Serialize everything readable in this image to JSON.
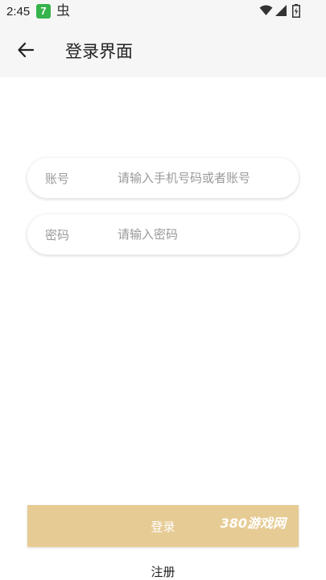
{
  "status_bar": {
    "time": "2:45",
    "app_badge": "7",
    "icons": [
      "bug-icon",
      "wifi-icon",
      "signal-icon",
      "battery-icon"
    ]
  },
  "header": {
    "title": "登录界面",
    "back_icon": "arrow-left-icon"
  },
  "form": {
    "account": {
      "label": "账号",
      "placeholder": "请输入手机号码或者账号",
      "value": ""
    },
    "password": {
      "label": "密码",
      "placeholder": "请输入密码",
      "value": ""
    }
  },
  "actions": {
    "login_label": "登录",
    "watermark": "380游戏网",
    "register_label": "注册"
  },
  "colors": {
    "accent": "#e6cb94",
    "header_bg": "#f6f6f6",
    "badge": "#36b34a"
  }
}
